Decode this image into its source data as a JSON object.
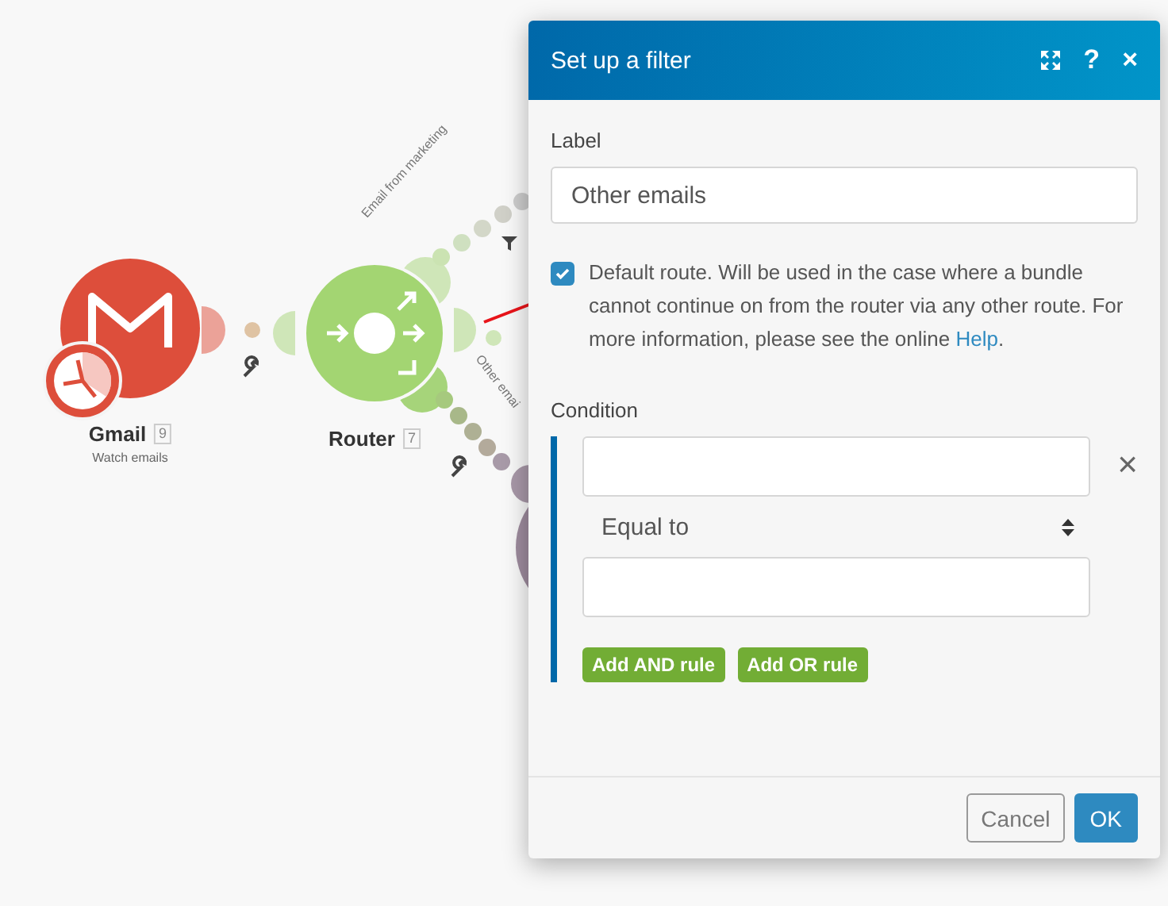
{
  "canvas": {
    "nodes": [
      {
        "kind": "gmail",
        "name": "Gmail",
        "badge": "9",
        "subtitle": "Watch emails"
      },
      {
        "kind": "router",
        "name": "Router",
        "badge": "7"
      }
    ],
    "routes": [
      {
        "label": "Email from marketing"
      },
      {
        "label": "Other emai"
      }
    ]
  },
  "dialog": {
    "title": "Set up a filter",
    "help_label": "?",
    "close_label": "×",
    "label_field": {
      "label": "Label",
      "value": "Other emails"
    },
    "default_route": {
      "checked": true,
      "text": "Default route. Will be used in the case where a bundle cannot continue on from the router via any other route. For more information, please see the online ",
      "link": "Help",
      "after": "."
    },
    "condition": {
      "label": "Condition",
      "remove_label": "×",
      "operator": "Equal to",
      "buttons": [
        "Add AND rule",
        "Add OR rule"
      ]
    },
    "footer": [
      {
        "label": "Cancel",
        "kind": "secondary"
      },
      {
        "label": "OK",
        "kind": "primary"
      }
    ]
  }
}
